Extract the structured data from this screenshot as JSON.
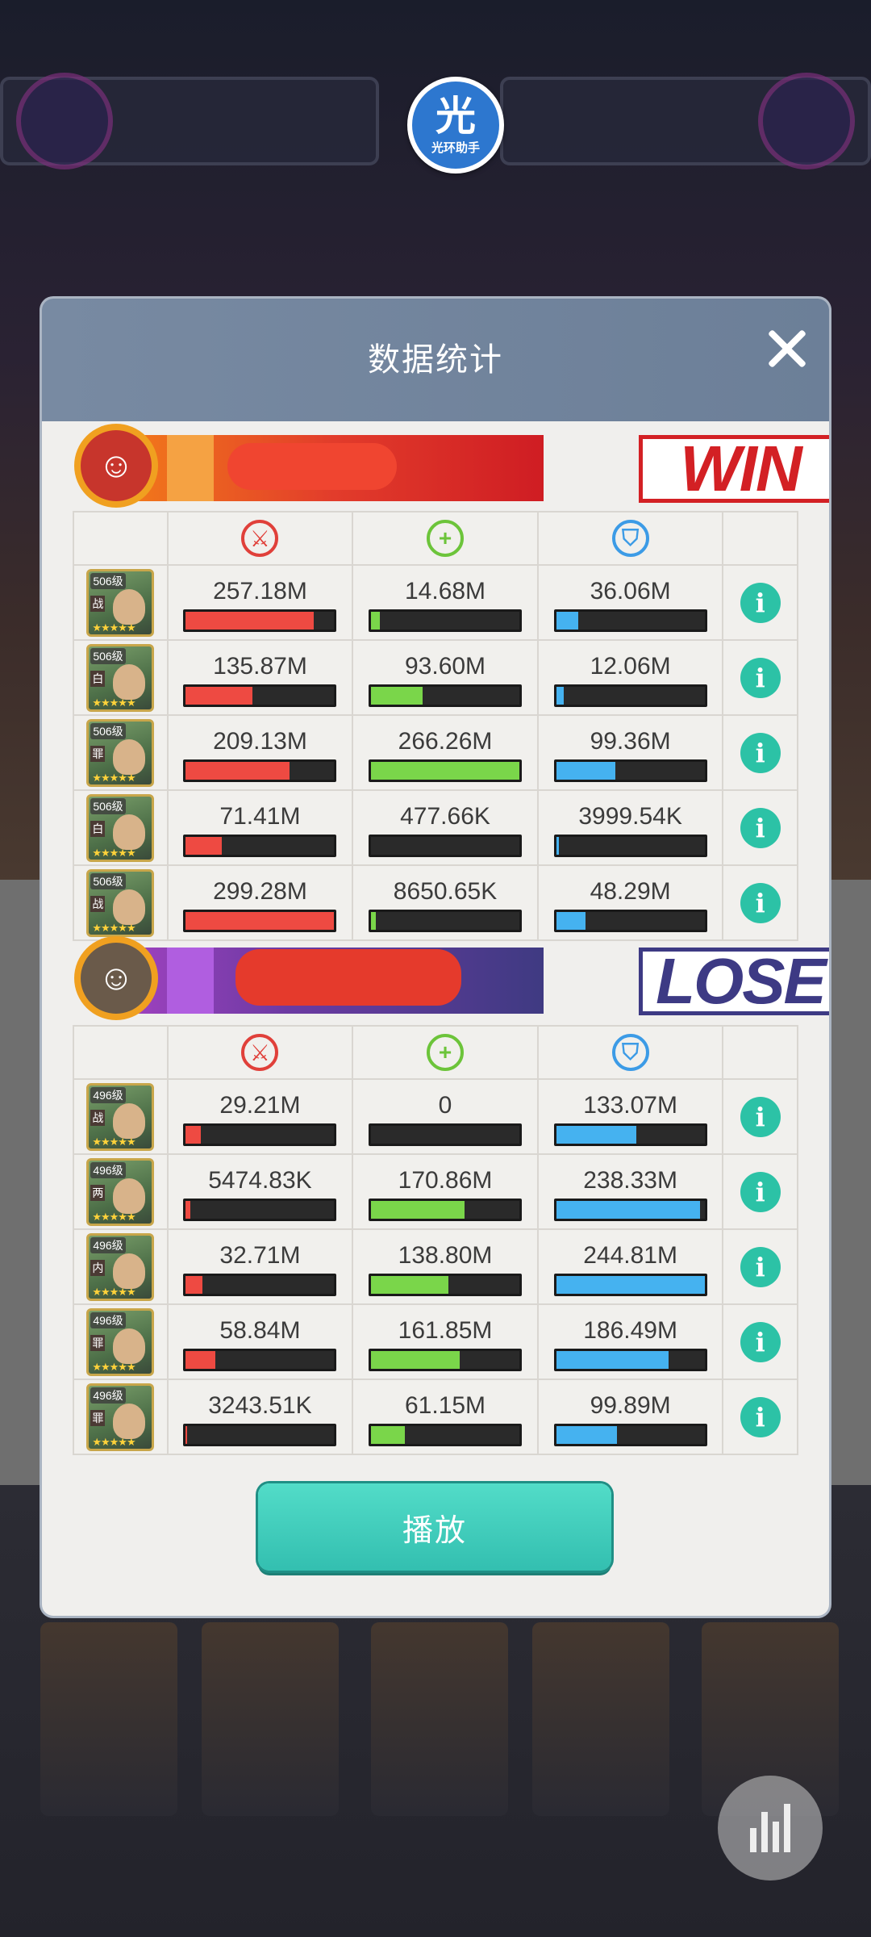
{
  "app": {
    "logo_char": "光",
    "logo_text": "光环助手"
  },
  "modal": {
    "title": "数据统计",
    "play_label": "播放"
  },
  "colors": {
    "attack": "#ee4a42",
    "heal": "#7ad64a",
    "defense": "#45b2f0",
    "info": "#2cc2a6"
  },
  "icons": {
    "attack": "sword-icon",
    "heal": "plus-icon",
    "defense": "shield-icon",
    "info": "info-icon"
  },
  "team_a": {
    "result": "WIN",
    "rows": [
      {
        "level": "506级",
        "tag": "战",
        "damage": "257.18M",
        "damage_pct": 86,
        "heal": "14.68M",
        "heal_pct": 6,
        "defense": "36.06M",
        "defense_pct": 15
      },
      {
        "level": "506级",
        "tag": "白",
        "damage": "135.87M",
        "damage_pct": 45,
        "heal": "93.60M",
        "heal_pct": 35,
        "defense": "12.06M",
        "defense_pct": 5
      },
      {
        "level": "506级",
        "tag": "罪",
        "damage": "209.13M",
        "damage_pct": 70,
        "heal": "266.26M",
        "heal_pct": 100,
        "defense": "99.36M",
        "defense_pct": 40
      },
      {
        "level": "506级",
        "tag": "白",
        "damage": "71.41M",
        "damage_pct": 24,
        "heal": "477.66K",
        "heal_pct": 0,
        "defense": "3999.54K",
        "defense_pct": 2
      },
      {
        "level": "506级",
        "tag": "战",
        "damage": "299.28M",
        "damage_pct": 100,
        "heal": "8650.65K",
        "heal_pct": 3,
        "defense": "48.29M",
        "defense_pct": 20
      }
    ]
  },
  "team_b": {
    "result": "LOSE",
    "rows": [
      {
        "level": "496级",
        "tag": "战",
        "damage": "29.21M",
        "damage_pct": 10,
        "heal": "0",
        "heal_pct": 0,
        "defense": "133.07M",
        "defense_pct": 54
      },
      {
        "level": "496级",
        "tag": "两",
        "damage": "5474.83K",
        "damage_pct": 3,
        "heal": "170.86M",
        "heal_pct": 63,
        "defense": "238.33M",
        "defense_pct": 97
      },
      {
        "level": "496级",
        "tag": "内",
        "damage": "32.71M",
        "damage_pct": 11,
        "heal": "138.80M",
        "heal_pct": 52,
        "defense": "244.81M",
        "defense_pct": 100
      },
      {
        "level": "496级",
        "tag": "罪",
        "damage": "58.84M",
        "damage_pct": 20,
        "heal": "161.85M",
        "heal_pct": 60,
        "defense": "186.49M",
        "defense_pct": 76
      },
      {
        "level": "496级",
        "tag": "罪",
        "damage": "3243.51K",
        "damage_pct": 1,
        "heal": "61.15M",
        "heal_pct": 23,
        "defense": "99.89M",
        "defense_pct": 41
      }
    ]
  }
}
